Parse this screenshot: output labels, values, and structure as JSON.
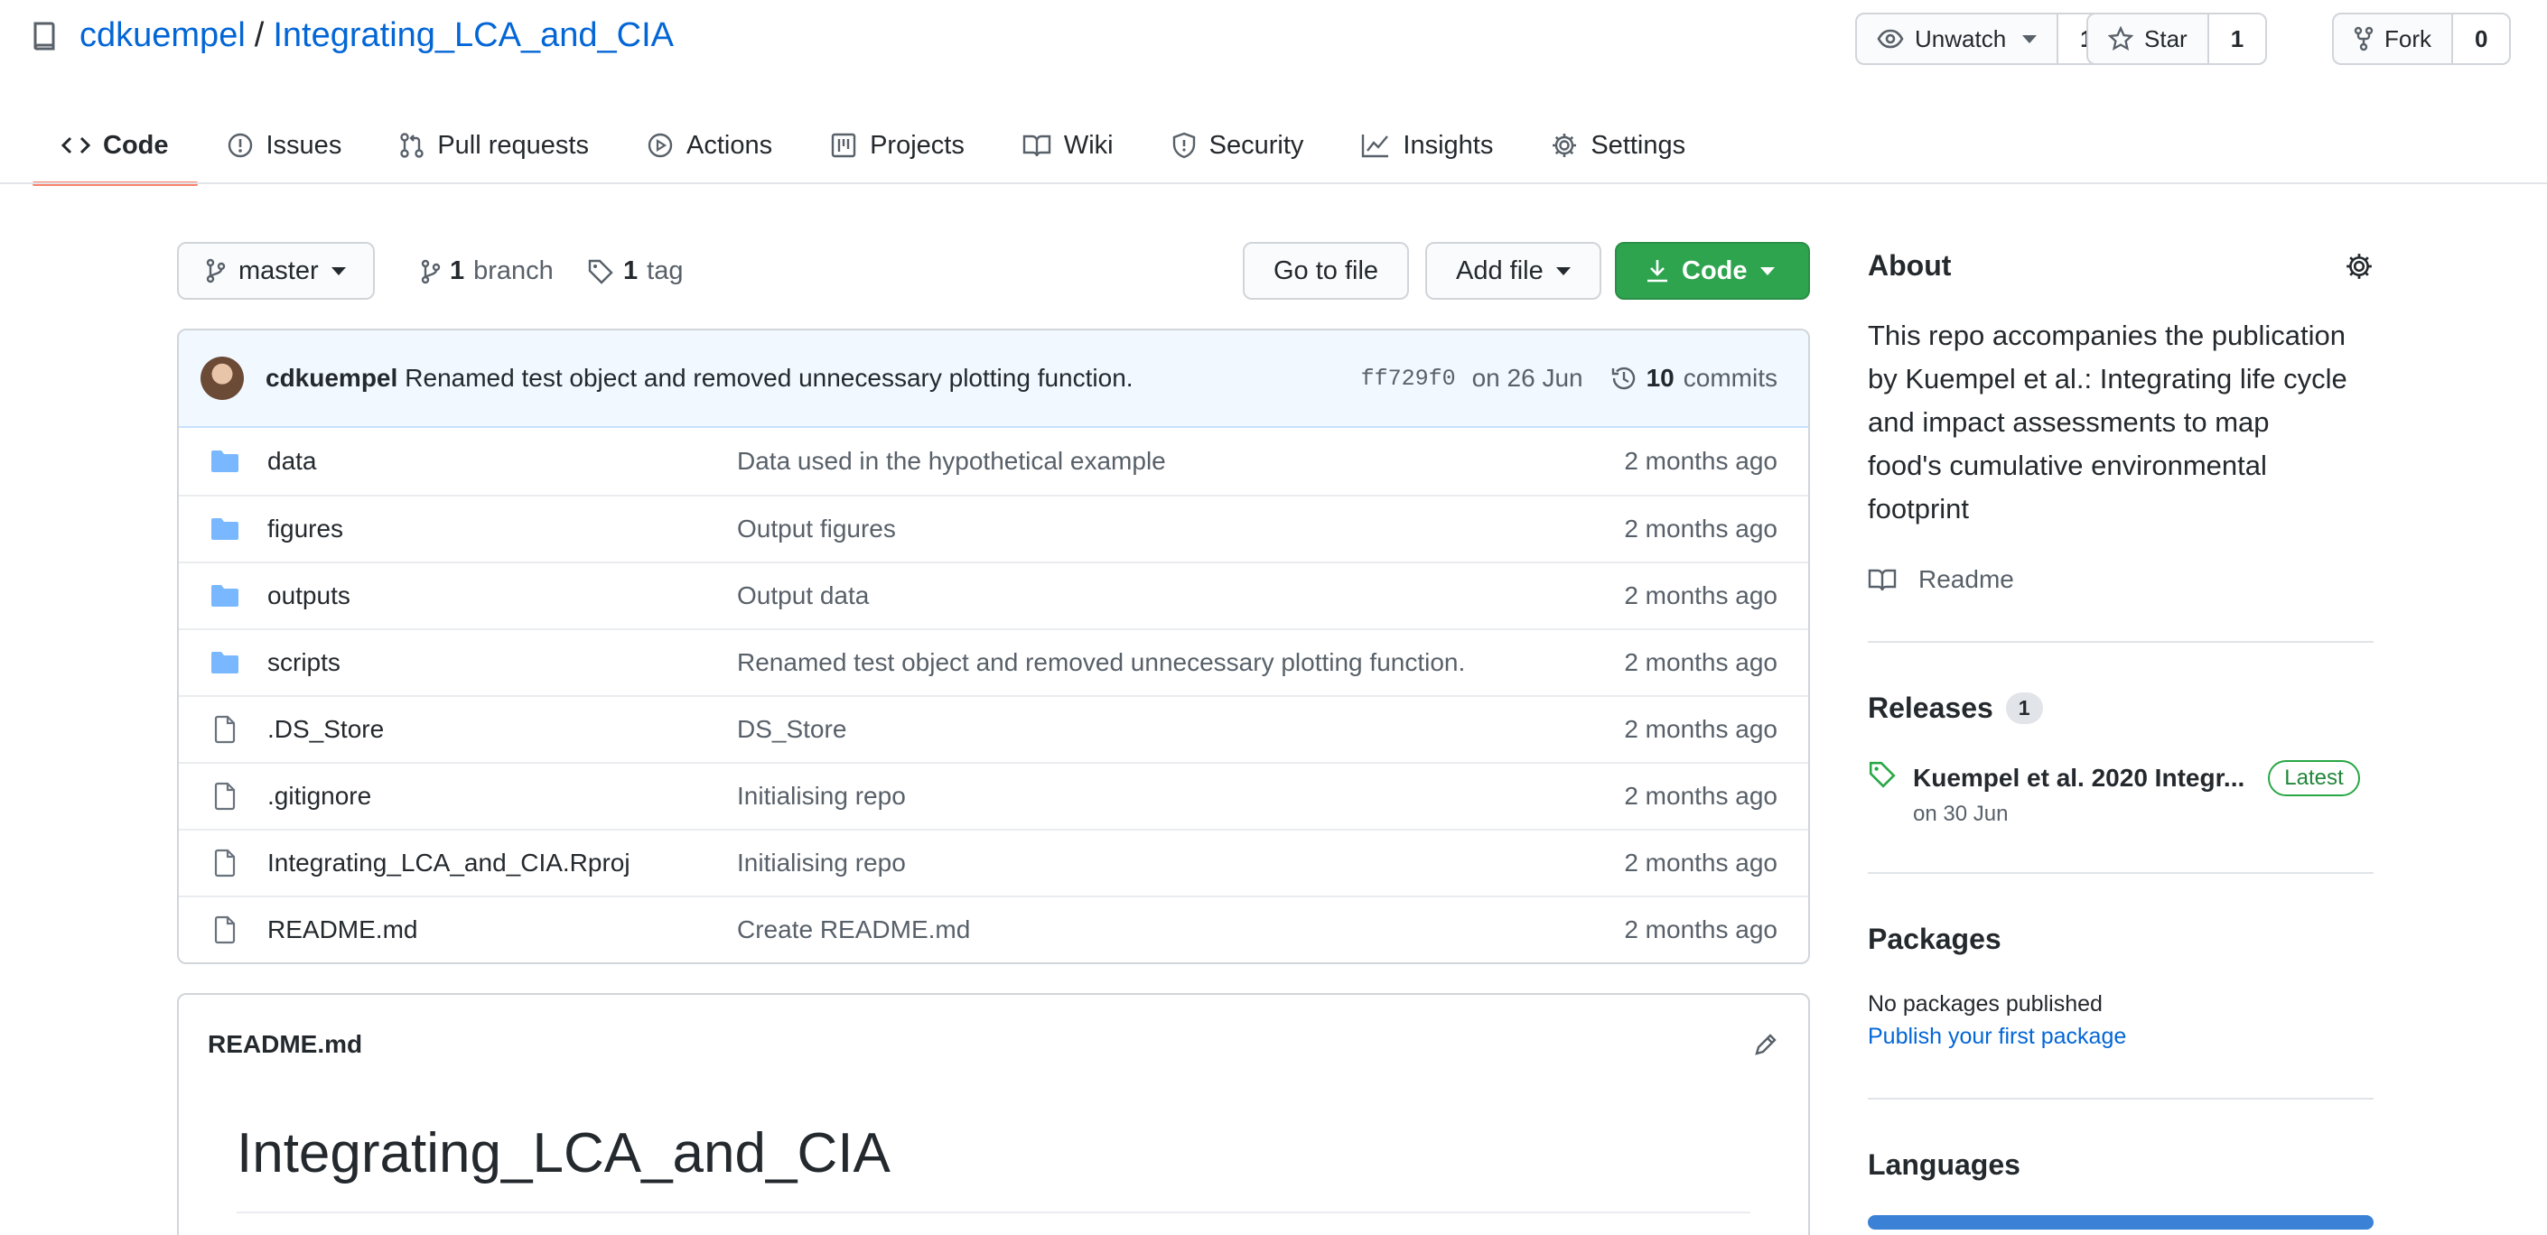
{
  "repo": {
    "owner": "cdkuempel",
    "separator": "/",
    "name": "Integrating_LCA_and_CIA"
  },
  "actions": {
    "watch": {
      "label": "Unwatch",
      "count": "1"
    },
    "star": {
      "label": "Star",
      "count": "1"
    },
    "fork": {
      "label": "Fork",
      "count": "0"
    }
  },
  "nav": [
    {
      "label": "Code",
      "icon": "code-icon"
    },
    {
      "label": "Issues",
      "icon": "issue-icon"
    },
    {
      "label": "Pull requests",
      "icon": "pull-request-icon"
    },
    {
      "label": "Actions",
      "icon": "play-icon"
    },
    {
      "label": "Projects",
      "icon": "project-icon"
    },
    {
      "label": "Wiki",
      "icon": "book-icon"
    },
    {
      "label": "Security",
      "icon": "shield-icon"
    },
    {
      "label": "Insights",
      "icon": "graph-icon"
    },
    {
      "label": "Settings",
      "icon": "gear-icon"
    }
  ],
  "toolbar": {
    "branch": "master",
    "branch_count": "1",
    "branch_label": "branch",
    "tag_count": "1",
    "tag_label": "tag",
    "go_to_file": "Go to file",
    "add_file": "Add file",
    "code": "Code"
  },
  "commit": {
    "author": "cdkuempel",
    "message": "Renamed test object and removed unnecessary plotting function.",
    "sha": "ff729f0",
    "date": "on 26 Jun",
    "count": "10",
    "count_label": "commits"
  },
  "files": [
    {
      "type": "dir",
      "name": "data",
      "message": "Data used in the hypothetical example",
      "age": "2 months ago"
    },
    {
      "type": "dir",
      "name": "figures",
      "message": "Output figures",
      "age": "2 months ago"
    },
    {
      "type": "dir",
      "name": "outputs",
      "message": "Output data",
      "age": "2 months ago"
    },
    {
      "type": "dir",
      "name": "scripts",
      "message": "Renamed test object and removed unnecessary plotting function.",
      "age": "2 months ago"
    },
    {
      "type": "file",
      "name": ".DS_Store",
      "message": "DS_Store",
      "age": "2 months ago"
    },
    {
      "type": "file",
      "name": ".gitignore",
      "message": "Initialising repo",
      "age": "2 months ago"
    },
    {
      "type": "file",
      "name": "Integrating_LCA_and_CIA.Rproj",
      "message": "Initialising repo",
      "age": "2 months ago"
    },
    {
      "type": "file",
      "name": "README.md",
      "message": "Create README.md",
      "age": "2 months ago"
    }
  ],
  "readme": {
    "filename": "README.md",
    "heading": "Integrating_LCA_and_CIA"
  },
  "sidebar": {
    "about_title": "About",
    "about_lines": [
      "This repo accompanies the publication",
      "by Kuempel et al.: Integrating life cycle",
      "and impact assessments to map",
      "food's cumulative environmental",
      "footprint"
    ],
    "readme_link": "Readme",
    "releases_title": "Releases",
    "releases_count": "1",
    "release_name": "Kuempel et al. 2020 Integr...",
    "release_badge": "Latest",
    "release_date": "on 30 Jun",
    "packages_title": "Packages",
    "packages_empty": "No packages published",
    "packages_link": "Publish your first package",
    "languages_title": "Languages"
  },
  "colors": {
    "link": "#0366d6",
    "green": "#2ea44f",
    "accent_underline": "#f9826c",
    "language_bar": "#3b82d6"
  }
}
